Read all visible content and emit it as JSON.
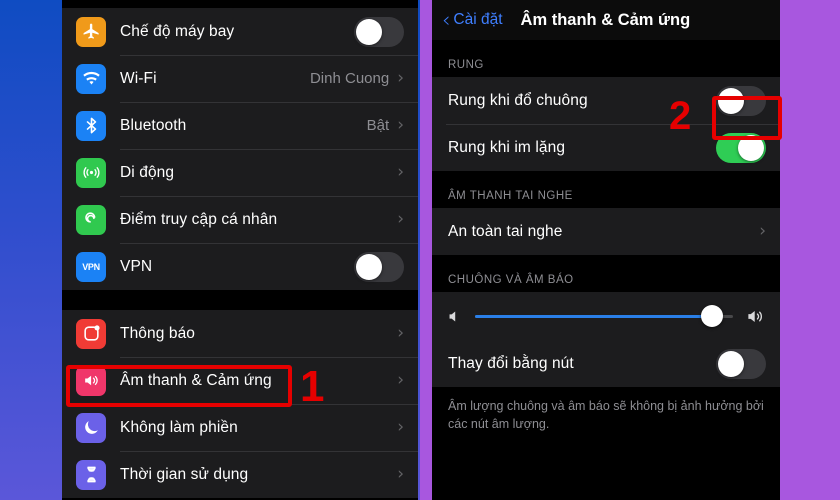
{
  "background": {
    "left_gradient_from": "#0f4cc2",
    "left_gradient_to": "#6a5de0",
    "right_color": "#a857df"
  },
  "left_panel": {
    "groups": [
      {
        "rows": [
          {
            "icon": "airplane-icon",
            "icon_color": "#f09a1a",
            "label": "Chế độ máy bay",
            "control": "toggle",
            "toggle_on": false
          },
          {
            "icon": "wifi-icon",
            "icon_color": "#1b82f5",
            "label": "Wi-Fi",
            "control": "value-chevron",
            "value": "Dinh Cuong"
          },
          {
            "icon": "bluetooth-icon",
            "icon_color": "#1b82f5",
            "label": "Bluetooth",
            "control": "value-chevron",
            "value": "Bật"
          },
          {
            "icon": "cellular-icon",
            "icon_color": "#30c94f",
            "label": "Di động",
            "control": "chevron",
            "value": ""
          },
          {
            "icon": "hotspot-icon",
            "icon_color": "#30c94f",
            "label": "Điểm truy cập cá nhân",
            "control": "chevron",
            "value": ""
          },
          {
            "icon": "vpn-icon",
            "icon_color": "#1b82f5",
            "label": "VPN",
            "control": "toggle",
            "toggle_on": false
          }
        ]
      },
      {
        "rows": [
          {
            "icon": "notifications-icon",
            "icon_color": "#f03b35",
            "label": "Thông báo",
            "control": "chevron",
            "value": ""
          },
          {
            "icon": "sounds-icon",
            "icon_color": "#f0366a",
            "label": "Âm thanh & Cảm ứng",
            "control": "chevron",
            "value": "",
            "highlighted": true
          },
          {
            "icon": "moon-icon",
            "icon_color": "#6b61e8",
            "label": "Không làm phiền",
            "control": "chevron",
            "value": ""
          },
          {
            "icon": "hourglass-icon",
            "icon_color": "#6b61e8",
            "label": "Thời gian sử dụng",
            "control": "chevron",
            "value": ""
          }
        ]
      }
    ]
  },
  "right_panel": {
    "nav": {
      "back_label": "Cài đặt",
      "back_icon": "chevron-left-icon",
      "title": "Âm thanh & Cảm ứng"
    },
    "sections": [
      {
        "header": "RUNG",
        "rows": [
          {
            "label": "Rung khi đổ chuông",
            "control": "toggle",
            "toggle_on": false,
            "highlighted": true
          },
          {
            "label": "Rung khi im lặng",
            "control": "toggle",
            "toggle_on": true
          }
        ]
      },
      {
        "header": "ÂM THANH TAI NGHE",
        "rows": [
          {
            "label": "An toàn tai nghe",
            "control": "chevron"
          }
        ]
      },
      {
        "header": "CHUÔNG VÀ ÂM BÁO",
        "slider": {
          "left_icon": "speaker-low-icon",
          "right_icon": "speaker-high-icon",
          "value_percent": 92,
          "fill_color": "#2a7fe8"
        },
        "rows": [
          {
            "label": "Thay đổi bằng nút",
            "control": "toggle",
            "toggle_on": false
          }
        ],
        "footnote": "Âm lượng chuông và âm báo sẽ không bị ảnh hưởng bởi các nút âm lượng."
      }
    ]
  },
  "annotations": [
    {
      "name": "step-1",
      "number": "1",
      "color": "#e60000"
    },
    {
      "name": "step-2",
      "number": "2",
      "color": "#e60000"
    }
  ]
}
